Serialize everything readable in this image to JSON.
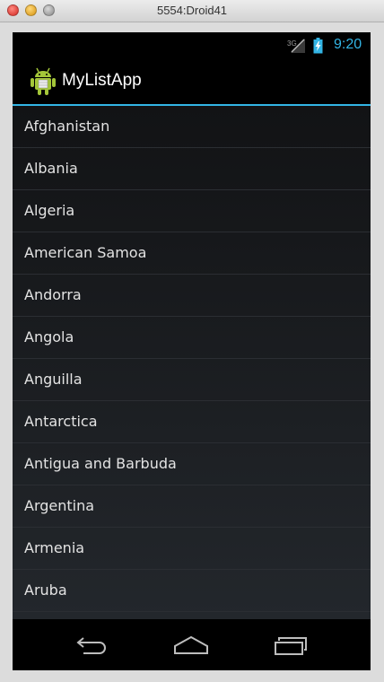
{
  "window": {
    "title": "5554:Droid41"
  },
  "status_bar": {
    "network": "3G",
    "time": "9:20",
    "accent": "#33b5e5"
  },
  "action_bar": {
    "app_title": "MyListApp",
    "icon": "android-robot-icon"
  },
  "list": {
    "items": [
      "Afghanistan",
      "Albania",
      "Algeria",
      "American Samoa",
      "Andorra",
      "Angola",
      "Anguilla",
      "Antarctica",
      "Antigua and Barbuda",
      "Argentina",
      "Armenia",
      "Aruba",
      ""
    ]
  },
  "nav_bar": {
    "icons": [
      "back-icon",
      "home-icon",
      "recent-apps-icon"
    ]
  }
}
